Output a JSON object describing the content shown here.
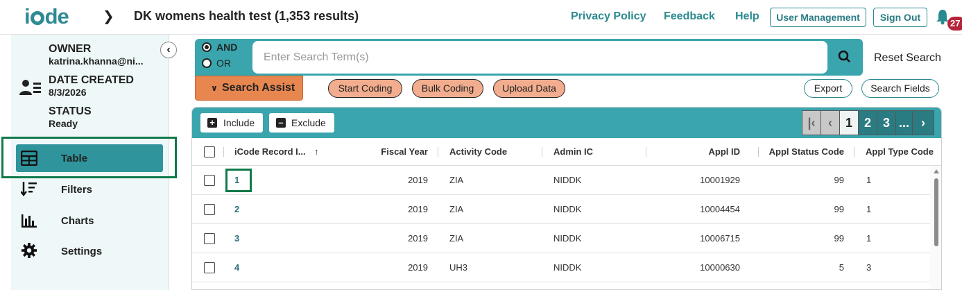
{
  "app": {
    "logo_prefix": "i",
    "logo_suffix": "de",
    "title": "DK womens health test (1,353 results)"
  },
  "header": {
    "links": [
      "Privacy Policy",
      "Feedback",
      "Help"
    ],
    "buttons": [
      "User Management",
      "Sign Out"
    ],
    "notification_count": "27"
  },
  "sidebar": {
    "owner_label": "OWNER",
    "owner_value": "katrina.khanna@ni...",
    "created_label": "DATE CREATED",
    "created_value": "8/3/2026",
    "status_label": "STATUS",
    "status_value": "Ready",
    "nav": [
      {
        "label": "Table",
        "icon": "table-icon",
        "active": true
      },
      {
        "label": "Filters",
        "icon": "filters-icon"
      },
      {
        "label": "Charts",
        "icon": "bar-chart-icon"
      },
      {
        "label": "Settings",
        "icon": "gear-icon"
      }
    ]
  },
  "search": {
    "and_label": "AND",
    "or_label": "OR",
    "selected": "AND",
    "placeholder": "Enter Search Term(s)",
    "value": "",
    "reset_label": "Reset Search",
    "assist_label": "Search Assist",
    "actions": [
      "Start Coding",
      "Bulk Coding",
      "Upload Data"
    ],
    "export_label": "Export",
    "fields_label": "Search Fields"
  },
  "table": {
    "include_label": "Include",
    "exclude_label": "Exclude",
    "pager": {
      "pages": [
        "1",
        "2",
        "3"
      ],
      "ellipsis": "...",
      "current": "1"
    },
    "columns": [
      "iCode Record I...",
      "Fiscal Year",
      "Activity Code",
      "Admin IC",
      "Appl ID",
      "Appl Status Code",
      "Appl Type Code"
    ],
    "rows": [
      [
        "1",
        "2019",
        "ZIA",
        "NIDDK",
        "10001929",
        "99",
        "1"
      ],
      [
        "2",
        "2019",
        "ZIA",
        "NIDDK",
        "10004454",
        "99",
        "1"
      ],
      [
        "3",
        "2019",
        "ZIA",
        "NIDDK",
        "10006715",
        "99",
        "1"
      ],
      [
        "4",
        "2019",
        "UH3",
        "NIDDK",
        "10000630",
        "5",
        "3"
      ]
    ]
  },
  "colors": {
    "teal": "#3aa5ad",
    "accent_orange": "#e7874f",
    "pill_orange": "#f2ad8e",
    "focus_green": "#0f7a4a",
    "badge_red": "#b5253a"
  }
}
